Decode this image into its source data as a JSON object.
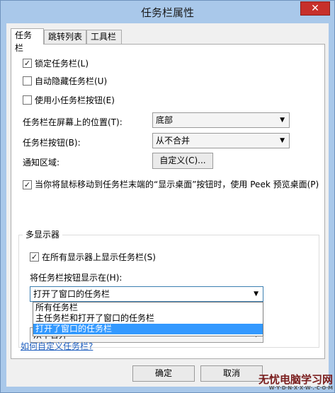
{
  "window": {
    "title": "任务栏属性",
    "close_glyph": "✕"
  },
  "tabs": [
    {
      "label": "任务栏"
    },
    {
      "label": "跳转列表"
    },
    {
      "label": "工具栏"
    }
  ],
  "taskbar": {
    "lock": {
      "label": "锁定任务栏(L)",
      "checked": true
    },
    "autohide": {
      "label": "自动隐藏任务栏(U)",
      "checked": false
    },
    "small_buttons": {
      "label": "使用小任务栏按钮(E)",
      "checked": false
    },
    "position_label": "任务栏在屏幕上的位置(T):",
    "position_value": "底部",
    "buttons_label": "任务栏按钮(B):",
    "buttons_value": "从不合并",
    "notification_label": "通知区域:",
    "customize_button": "自定义(C)...",
    "peek": {
      "label": "当你将鼠标移动到任务栏末端的“显示桌面”按钮时，使用 Peek 预览桌面(P)",
      "checked": true
    }
  },
  "multi_display": {
    "group_title": "多显示器",
    "show_all": {
      "label": "在所有显示器上显示任务栏(S)",
      "checked": true
    },
    "show_buttons_label": "将任务栏按钮显示在(H):",
    "show_buttons_value": "打开了窗口的任务栏",
    "dropdown_options": [
      "所有任务栏",
      "主任务栏和打开了窗口的任务栏",
      "打开了窗口的任务栏"
    ],
    "selected_index": 2,
    "hidden_select_value": "从不合并"
  },
  "help_link": "如何自定义任务栏?",
  "footer": {
    "ok": "确定",
    "cancel": "取消"
  },
  "watermark": {
    "text": "无忧电脑学习网",
    "sub": "W·Y·D·N·X·X·W·.·C·O·M"
  },
  "check_glyph": "✓",
  "arrow_glyph": "▼"
}
